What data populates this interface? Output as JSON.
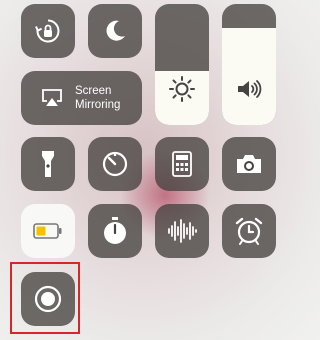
{
  "controls": {
    "screen_mirroring": {
      "label_line1": "Screen",
      "label_line2": "Mirroring",
      "icon": "airplay-icon"
    },
    "orientation_lock": {
      "icon": "rotation-lock-icon",
      "state": "on"
    },
    "do_not_disturb": {
      "icon": "moon-icon",
      "state": "off"
    },
    "brightness": {
      "icon": "sun-icon",
      "level": 0.45
    },
    "volume": {
      "icon": "speaker-icon",
      "level": 0.8
    },
    "flashlight": {
      "icon": "flashlight-icon"
    },
    "timer": {
      "icon": "timer-icon"
    },
    "calculator": {
      "icon": "calculator-icon"
    },
    "camera": {
      "icon": "camera-icon"
    },
    "low_power_mode": {
      "icon": "battery-icon",
      "state": "on"
    },
    "stopwatch": {
      "icon": "stopwatch-icon"
    },
    "voice_memos": {
      "icon": "waveform-icon"
    },
    "alarm": {
      "icon": "alarm-clock-icon"
    },
    "screen_recording": {
      "icon": "record-icon",
      "highlighted": true
    }
  },
  "colors": {
    "tile": "#46423f",
    "tile_active": "#f8f8f6",
    "battery_low_power": "#f2c200",
    "highlight_border": "#d9252a"
  }
}
